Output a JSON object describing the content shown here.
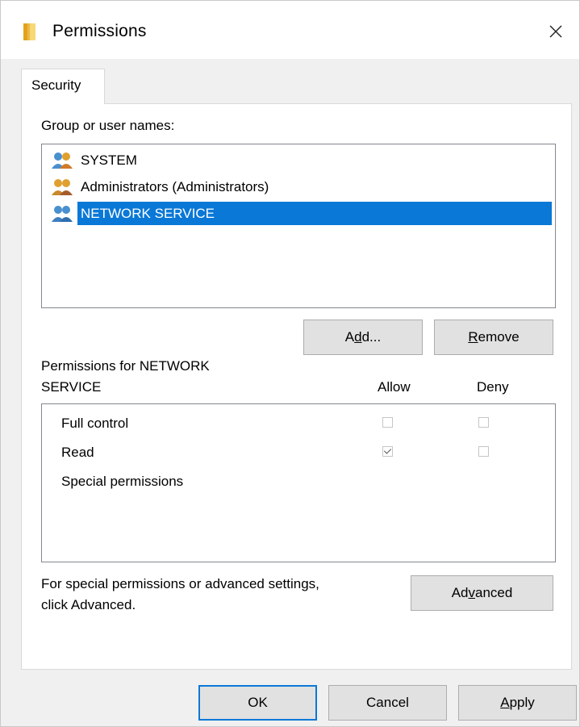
{
  "window": {
    "title": "Permissions",
    "close_glyph": "✕"
  },
  "tabs": [
    {
      "label": "Security",
      "active": true
    }
  ],
  "security": {
    "group_label": "Group or user names:",
    "users": [
      {
        "name": "SYSTEM",
        "icon": "users-group-icon",
        "selected": false
      },
      {
        "name": "Administrators (Administrators)",
        "icon": "users-group-icon",
        "selected": false
      },
      {
        "name": "NETWORK SERVICE",
        "icon": "users-group-icon",
        "selected": true
      }
    ],
    "add_button": {
      "pre": "A",
      "underlined": "d",
      "post": "d..."
    },
    "remove_button": {
      "pre": "",
      "underlined": "R",
      "post": "emove"
    },
    "permissions_label_line1": "Permissions for NETWORK",
    "permissions_label_line2": "SERVICE",
    "allow_header": "Allow",
    "deny_header": "Deny",
    "permissions": [
      {
        "name": "Full control",
        "allow": false,
        "deny": false
      },
      {
        "name": "Read",
        "allow": true,
        "deny": false
      },
      {
        "name": "Special permissions",
        "allow": false,
        "deny": false
      }
    ],
    "special_text_line1": "For special permissions or advanced settings,",
    "special_text_line2": "click Advanced.",
    "advanced_button": {
      "pre": "Ad",
      "underlined": "v",
      "post": "anced"
    }
  },
  "footer": {
    "ok_label": "OK",
    "cancel_label": "Cancel",
    "apply_button": {
      "pre": "",
      "underlined": "A",
      "post": "pply"
    }
  },
  "colors": {
    "selection": "#0a78d7",
    "dialog_bg": "#f0f0f0",
    "button_bg": "#e1e1e1"
  }
}
